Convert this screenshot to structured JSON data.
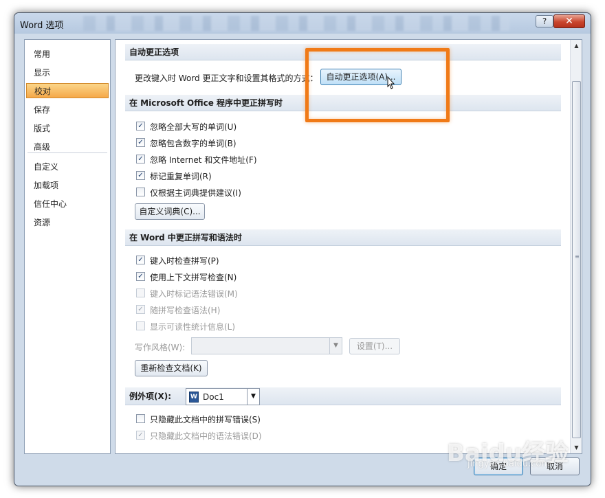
{
  "window": {
    "title": "Word 选项",
    "help_label": "?",
    "close_label": "✕"
  },
  "nav": {
    "items": [
      {
        "label": "常用"
      },
      {
        "label": "显示"
      },
      {
        "label": "校对",
        "selected": true
      },
      {
        "label": "保存"
      },
      {
        "label": "版式"
      },
      {
        "label": "高级"
      },
      {
        "label": "自定义"
      },
      {
        "label": "加载项"
      },
      {
        "label": "信任中心"
      },
      {
        "label": "资源"
      }
    ]
  },
  "autocorrect": {
    "header": "自动更正选项",
    "description": "更改键入时 Word 更正文字和设置其格式的方式：",
    "button_label": "自动更正选项(A)..."
  },
  "office_spelling": {
    "header": "在 Microsoft Office 程序中更正拼写时",
    "options": [
      {
        "label": "忽略全部大写的单词(U)",
        "checked": true
      },
      {
        "label": "忽略包含数字的单词(B)",
        "checked": true
      },
      {
        "label": "忽略 Internet 和文件地址(F)",
        "checked": true
      },
      {
        "label": "标记重复单词(R)",
        "checked": true
      },
      {
        "label": "仅根据主词典提供建议(I)",
        "checked": false
      }
    ],
    "custom_dict_button": "自定义词典(C)..."
  },
  "word_grammar": {
    "header": "在 Word 中更正拼写和语法时",
    "options": [
      {
        "label": "键入时检查拼写(P)",
        "checked": true,
        "enabled": true
      },
      {
        "label": "使用上下文拼写检查(N)",
        "checked": true,
        "enabled": true
      },
      {
        "label": "键入时标记语法错误(M)",
        "checked": false,
        "enabled": false
      },
      {
        "label": "随拼写检查语法(H)",
        "checked": true,
        "enabled": false
      },
      {
        "label": "显示可读性统计信息(L)",
        "checked": false,
        "enabled": false
      }
    ],
    "writing_style_label": "写作风格(W):",
    "writing_style_value": "",
    "settings_button": "设置(T)...",
    "recheck_button": "重新检查文档(K)"
  },
  "exceptions": {
    "label": "例外项(X):",
    "document": "Doc1",
    "doc_icon": "W",
    "options": [
      {
        "label": "只隐藏此文档中的拼写错误(S)",
        "checked": false,
        "enabled": true
      },
      {
        "label": "只隐藏此文档中的语法错误(D)",
        "checked": true,
        "enabled": false
      }
    ]
  },
  "footer": {
    "ok_label": "确定",
    "cancel_label": "取消"
  },
  "watermark": {
    "text": "Baidu经验",
    "sub": "jingyan.baidu.com"
  },
  "colors": {
    "highlight_box": "#f07a17",
    "selected_nav": "#f5a849"
  }
}
